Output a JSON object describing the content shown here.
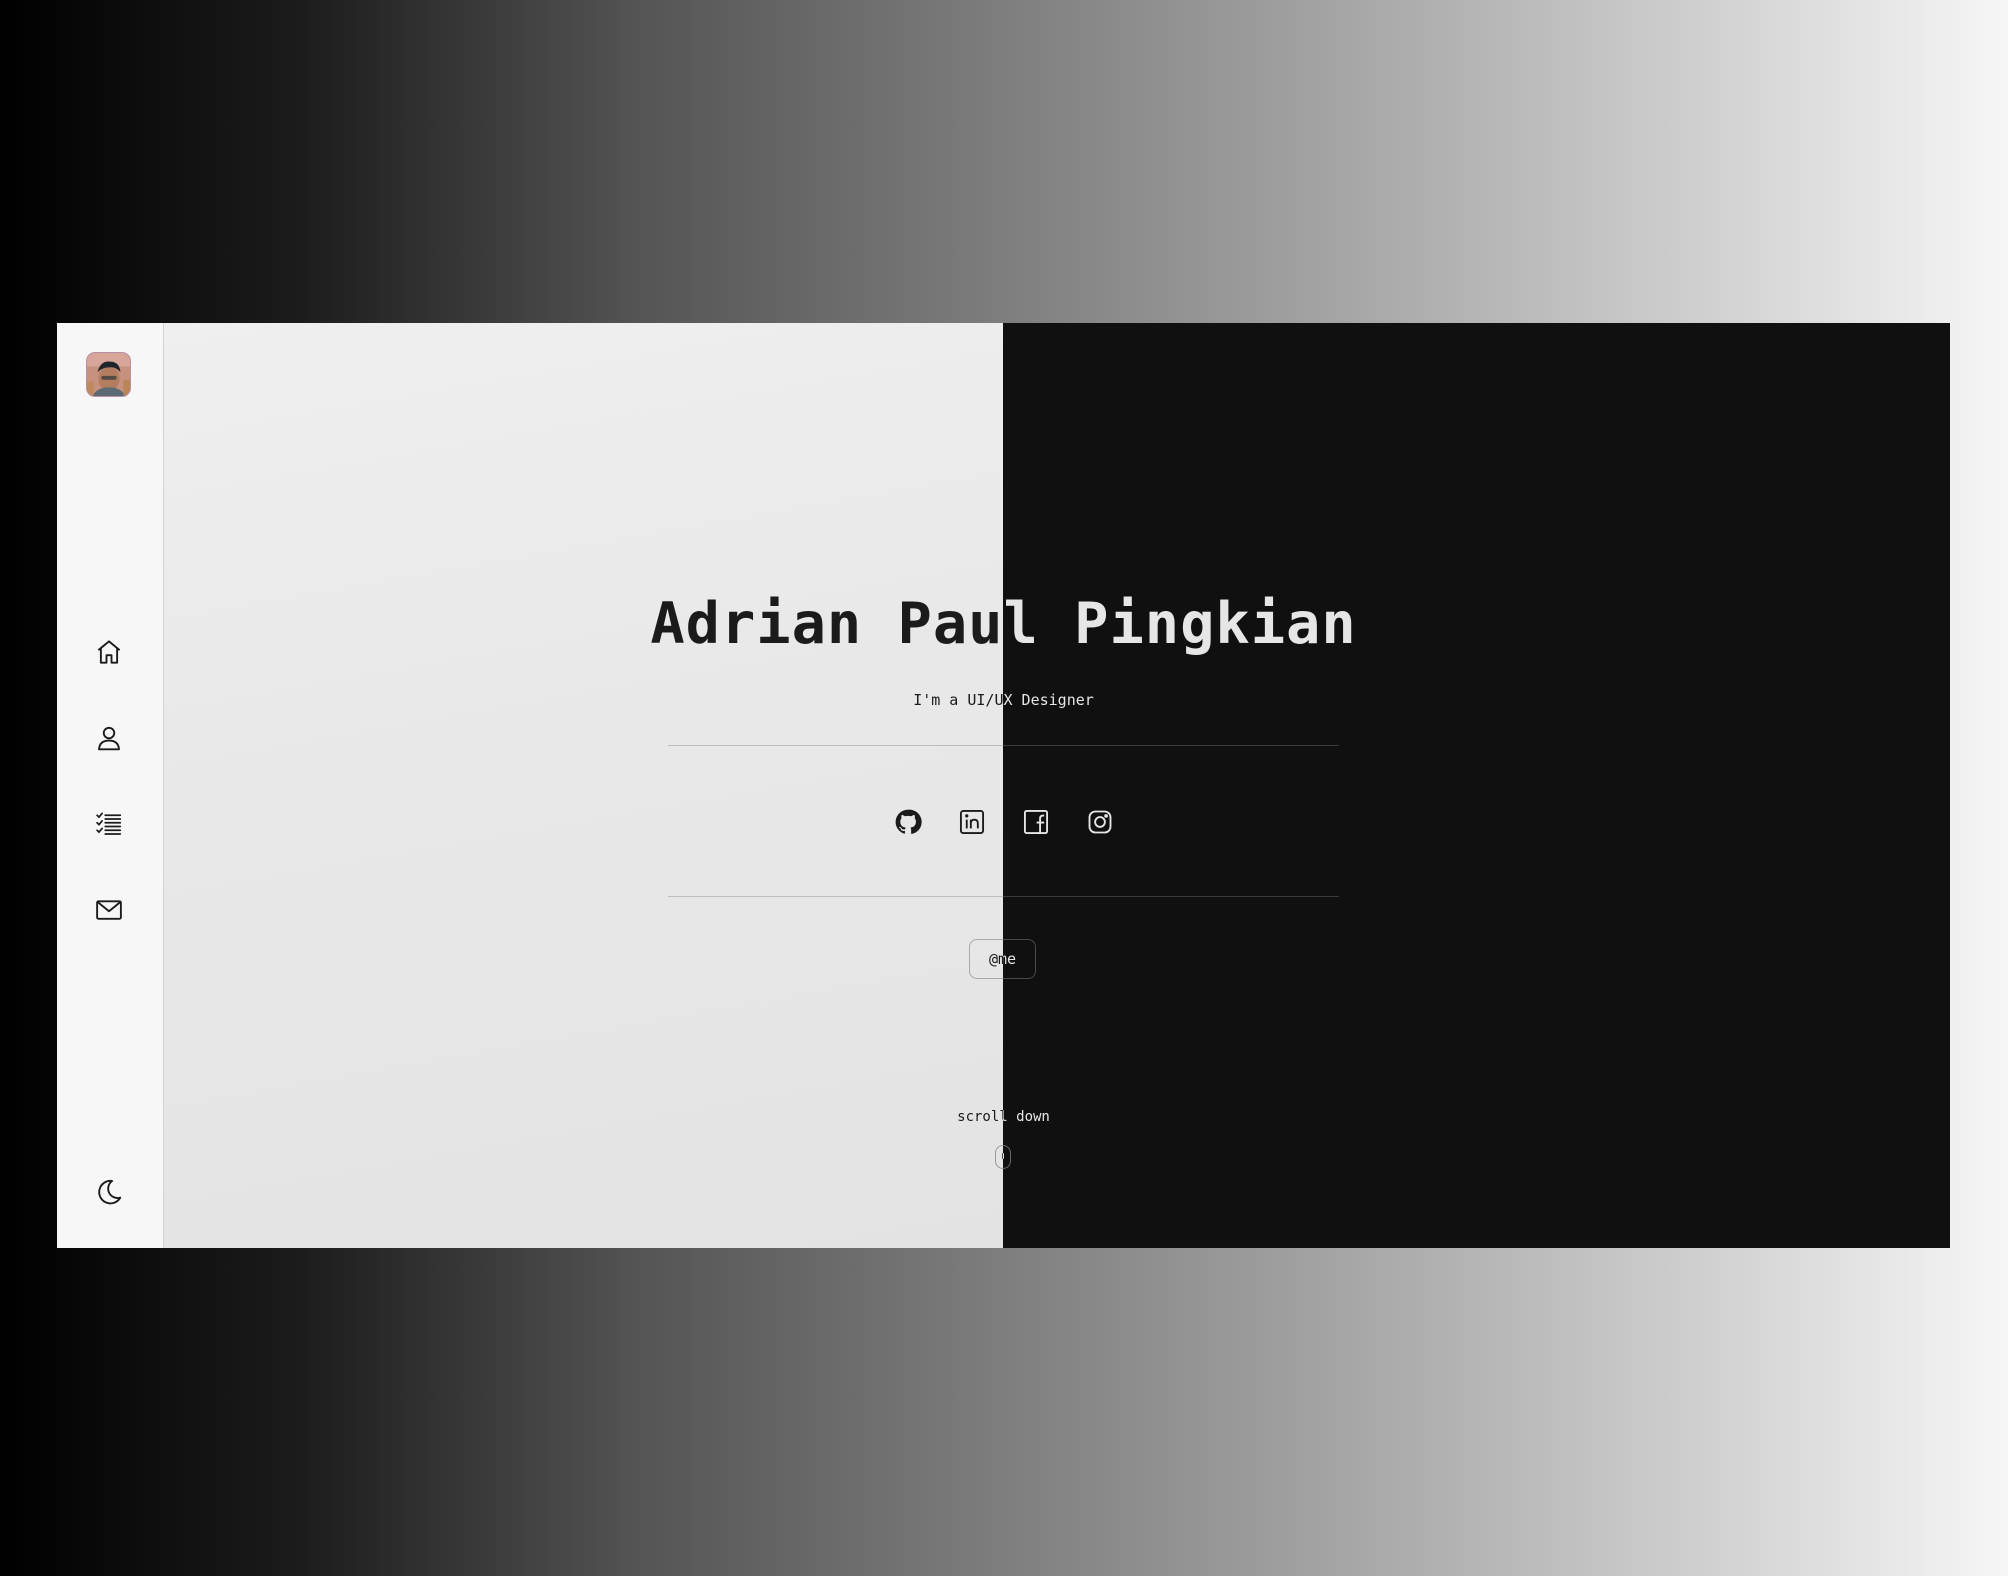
{
  "sidebar": {
    "avatar_alt": "profile avatar",
    "items": [
      {
        "name": "home",
        "icon": "home-icon"
      },
      {
        "name": "about",
        "icon": "user-icon"
      },
      {
        "name": "projects",
        "icon": "list-icon"
      },
      {
        "name": "contact",
        "icon": "mail-icon"
      }
    ],
    "theme_toggle_icon": "moon-icon"
  },
  "hero": {
    "name": "Adrian Paul Pingkian",
    "subtitle": "I'm a UI/UX Designer",
    "socials": [
      {
        "name": "github",
        "icon": "github-icon"
      },
      {
        "name": "linkedin",
        "icon": "linkedin-icon"
      },
      {
        "name": "facebook",
        "icon": "facebook-icon"
      },
      {
        "name": "instagram",
        "icon": "instagram-icon"
      }
    ],
    "me_button": "@me",
    "scroll_label": "scroll down"
  },
  "colors": {
    "light_bg": "#e9e9e9",
    "dark_bg": "#101010",
    "sidebar_bg": "#f7f7f7",
    "text_dark": "#1b1b1b",
    "text_light": "#e6e6e6"
  }
}
